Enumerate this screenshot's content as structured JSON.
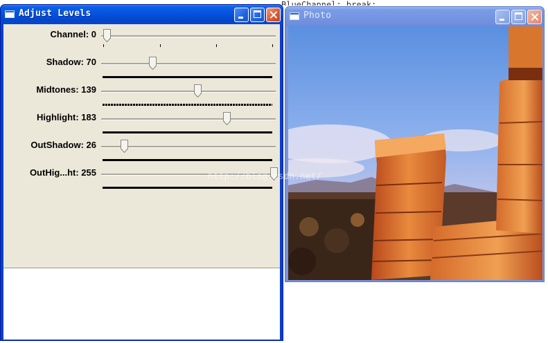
{
  "background": {
    "code_snippet": "BlueChannel; break;"
  },
  "levels_window": {
    "title": "Adjust Levels",
    "controls": [
      {
        "label": "Channel: 0",
        "value": 0,
        "max": 3,
        "indicator": "ticks"
      },
      {
        "label": "Shadow: 70",
        "value": 70,
        "max": 255,
        "indicator": "solid"
      },
      {
        "label": "Midtones: 139",
        "value": 139,
        "max": 255,
        "indicator": "dashed"
      },
      {
        "label": "Highlight: 183",
        "value": 183,
        "max": 255,
        "indicator": "solid"
      },
      {
        "label": "OutShadow: 26",
        "value": 26,
        "max": 255,
        "indicator": "solid"
      },
      {
        "label": "OutHig...ht: 255",
        "value": 255,
        "max": 255,
        "indicator": "solid"
      }
    ]
  },
  "photo_window": {
    "title": "Photo",
    "watermark": "http://blog.csdn.net/"
  },
  "colors": {
    "titlebar_active": "#0653de",
    "titlebar_inactive": "#7595e2",
    "dialog_face": "#ebe8d9",
    "close_button": "#e05a32"
  }
}
